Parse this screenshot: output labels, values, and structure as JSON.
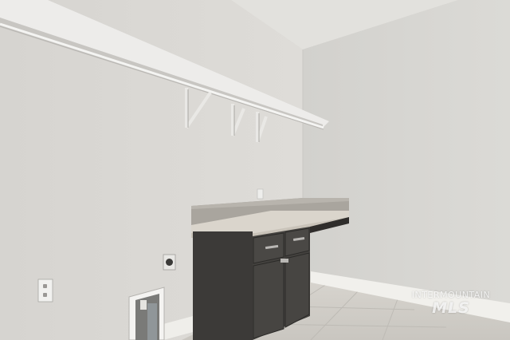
{
  "watermark": {
    "line1": "INTERMOUNTAIN",
    "line2": "MLS"
  },
  "colors": {
    "wall_left": "#dcdad6",
    "wall_right": "#d4d3cf",
    "ceiling": "#e3e2de",
    "cabinet": "#3a3836",
    "countertop": "#d8d3ca",
    "floor": "#cfccc6",
    "trim": "#f1f0ed"
  }
}
